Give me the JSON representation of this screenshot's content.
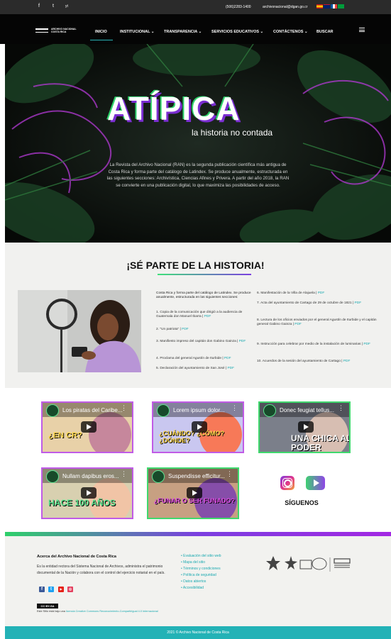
{
  "topbar": {
    "social": [
      "f",
      "t",
      "yt"
    ],
    "phone": "(506)2283-1400",
    "email": "archivonacional@dgan.go.cr",
    "languages": [
      "es",
      "en",
      "fr",
      "pt"
    ]
  },
  "nav": {
    "logo_text": "ARCHIVO NACIONAL COSTA RICA",
    "items": [
      "INICIO",
      "INSTITUCIONAL ⌄",
      "TRANSPARENCIA ⌄",
      "SERVICIOS EDUCATIVOS ⌄",
      "CONTÁCTENOS ⌄",
      "BUSCAR"
    ]
  },
  "hero": {
    "title": "ATÍPICA",
    "subtitle": "la historia no contada",
    "text": "La Revista del Archivo Nacional (RAN) es la segunda publicación científica más antigua de Costa Rica y forma parte del catálogo de Latindex. Se produce anualmente, estructurada en las siguientes secciones: Archivística, Ciencias Afines y Privera. A partir del año 2018, la RAN se convierte en una publicación digital, lo que maximiza las posibilidades de acceso."
  },
  "section": {
    "heading": "¡SÉ PARTE DE LA HISTORIA!",
    "intro": "Costa Rica y forma parte del catálogo de Latindex. Se produce anualmente, estructurada en las siguientes secciones:",
    "pdf_label": "PDF",
    "list_left": [
      "1. Copia de la comunicación que dirigió a la audiencia de Guatemala don Manuel Ibarra |",
      "2. \"Un patriota\" |",
      "3. Manifiesto impreso del capitán don Gabino Gainza |",
      "4. Proclama del general Agustín de Iturbide |",
      "5. Declaración del ayuntamiento de San José |"
    ],
    "list_right": [
      "6. Manifestación de la Villa de Alajuela |",
      "7. Acta del ayuntamiento de Cartago de 29 de octubre de 1821 |",
      "8. Lectura de los oficios enviados por el general Agustín de Iturbide y el capitán general Gabino Gainza |",
      "9. Instrucción para celebrar por medio de la instalación de luminarias |",
      "10. Acuerdos de la sesión del ayuntamiento de Cartago |"
    ]
  },
  "videos": [
    {
      "title": "Los piratas del Caribe...",
      "overlay": "¿EN CR?",
      "overlay_color": "#ffd84a"
    },
    {
      "title": "Lorem ipsum dolor...",
      "overlay": "¿CUÁNDO? ¿CÓMO? ¿DÓNDE?",
      "overlay_color": "#ffd84a"
    },
    {
      "title": "Donec feugiat tellus...",
      "overlay": "UNA CHICA AL PODER",
      "overlay_color": "#ffffff"
    },
    {
      "title": "Nullam dapibus eros...",
      "overlay": "HACE 100 AÑOS",
      "overlay_color": "#5de28f"
    },
    {
      "title": "Suspendisse efficitur...",
      "overlay": "¿FUNAR O SER FUNADO?",
      "overlay_color": "#e14be6"
    }
  ],
  "follow": {
    "label": "SÍGUENOS",
    "icons": [
      "instagram-icon",
      "youtube-icon"
    ]
  },
  "footer": {
    "title": "Acerca del Archivo Nacional de Costa Rica",
    "text": "Es la entidad rectora del Sistema Nacional de Archivos, administra el patrimonio documental de la Nación y colabora con el control del ejercicio notarial en el país.",
    "social": [
      "f",
      "t",
      "▶",
      "◎"
    ],
    "links": [
      "• Evaluación del sitio web",
      "• Mapa del sitio",
      "• Términos y condiciones",
      "• Política de seguridad",
      "• Datos abiertos",
      "• Accesibilidad"
    ],
    "cc_badge": "CC BY-SA",
    "license_prefix": "Este Sitio está bajo una ",
    "license_link": "licencia Creative Commons Reconocimiento-CompartirIgual 4.0 Internacional",
    "copyright": "2021 © Archivo Nacional de Costa Rica"
  },
  "colors": {
    "accent_teal": "#23b2b6",
    "accent_green": "#2ed06a",
    "accent_purple": "#7b3fe0"
  }
}
